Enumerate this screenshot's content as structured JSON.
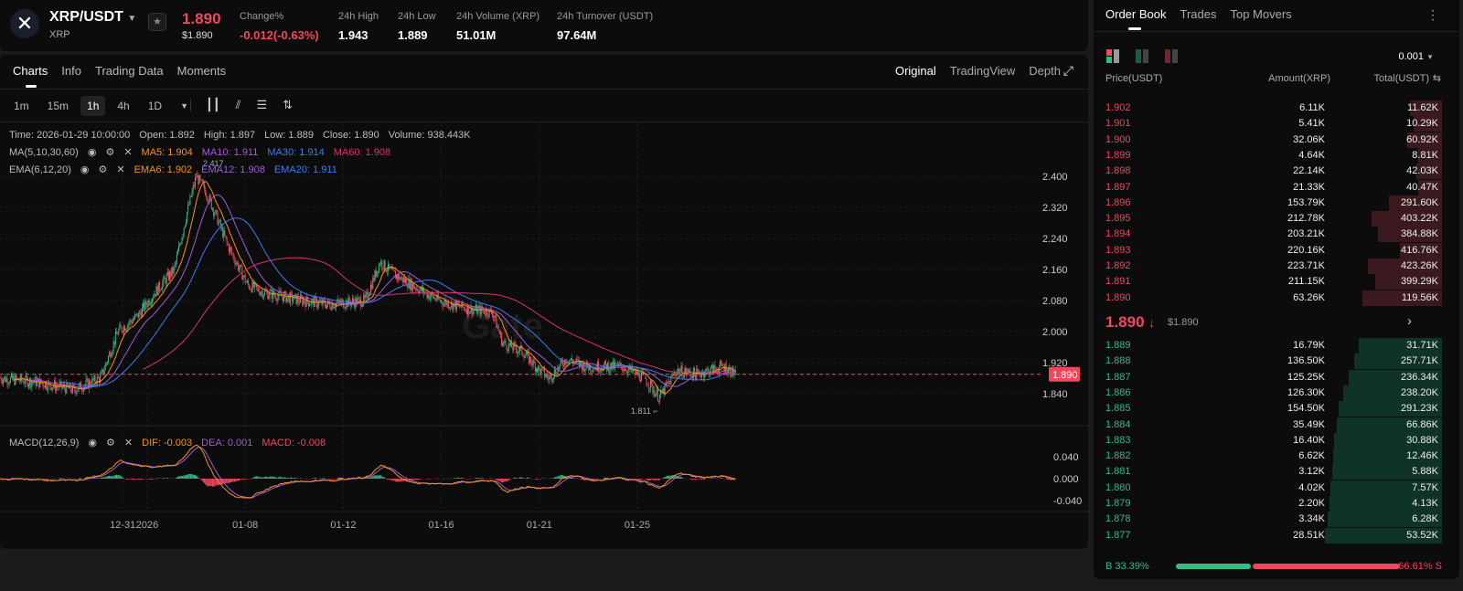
{
  "header": {
    "pair": "XRP/USDT",
    "base": "XRP",
    "last_price": "1.890",
    "last_price_usd": "$1.890",
    "stats": [
      {
        "label": "Change%",
        "value": "-0.012(-0.63%)",
        "color": "#f0485c"
      },
      {
        "label": "24h High",
        "value": "1.943"
      },
      {
        "label": "24h Low",
        "value": "1.889"
      },
      {
        "label": "24h Volume (XRP)",
        "value": "51.01M"
      },
      {
        "label": "24h Turnover (USDT)",
        "value": "97.64M"
      }
    ]
  },
  "tabs": [
    "Charts",
    "Info",
    "Trading Data",
    "Moments"
  ],
  "view_tabs": [
    "Original",
    "TradingView",
    "Depth"
  ],
  "intervals": [
    "1m",
    "15m",
    "1h",
    "4h",
    "1D"
  ],
  "active_interval": "1h",
  "legend": {
    "ohlc": [
      "Time: 2026-01-29 10:00:00",
      "Open: 1.892",
      "High: 1.897",
      "Low: 1.889",
      "Close: 1.890",
      "Volume: 938.443K"
    ],
    "ma_label": "MA(5,10,30,60)",
    "ma": [
      {
        "t": "MA5: 1.904",
        "c": "#f7931a"
      },
      {
        "t": "MA10: 1.911",
        "c": "#a05cd6"
      },
      {
        "t": "MA30: 1.914",
        "c": "#3d7bf2"
      },
      {
        "t": "MA60: 1.908",
        "c": "#d8336b"
      }
    ],
    "ema_label": "EMA(6,12,20)",
    "ema": [
      {
        "t": "EMA6: 1.902",
        "c": "#f7931a"
      },
      {
        "t": "EMA12: 1.908",
        "c": "#a05cd6"
      },
      {
        "t": "EMA20: 1.911",
        "c": "#3d7bf2"
      }
    ],
    "macd_label": "MACD(12,26,9)",
    "macd": [
      {
        "t": "DIF: -0.003",
        "c": "#f7931a"
      },
      {
        "t": "DEA: 0.001",
        "c": "#a05cd6"
      },
      {
        "t": "MACD: -0.008",
        "c": "#f0485c"
      }
    ]
  },
  "chart_data": {
    "type": "candlestick",
    "watermark": "Gate",
    "y_ticks": [
      "2.400",
      "2.320",
      "2.240",
      "2.160",
      "2.080",
      "2.000",
      "1.920",
      "1.840"
    ],
    "ylim": [
      1.78,
      2.44
    ],
    "macd_ticks": [
      "0.040",
      "0.000",
      "-0.040"
    ],
    "x_ticks": [
      {
        "label": "12-31",
        "day": -1
      },
      {
        "label": "2026",
        "day": 0
      },
      {
        "label": "01-08",
        "day": 4
      },
      {
        "label": "01-12",
        "day": 8
      },
      {
        "label": "01-16",
        "day": 12
      },
      {
        "label": "01-21",
        "day": 16
      },
      {
        "label": "01-25",
        "day": 20
      }
    ],
    "price_path": [
      [
        -6,
        1.88
      ],
      [
        -4.5,
        1.87
      ],
      [
        -3,
        1.85
      ],
      [
        -1.9,
        1.88
      ],
      [
        -1.2,
        2.0
      ],
      [
        -0.4,
        2.04
      ],
      [
        0.3,
        2.1
      ],
      [
        1.1,
        2.16
      ],
      [
        1.6,
        2.3
      ],
      [
        2.0,
        2.4
      ],
      [
        2.4,
        2.36
      ],
      [
        2.8,
        2.3
      ],
      [
        3.3,
        2.22
      ],
      [
        4.1,
        2.12
      ],
      [
        4.8,
        2.1
      ],
      [
        6.3,
        2.08
      ],
      [
        7.4,
        2.07
      ],
      [
        8.9,
        2.08
      ],
      [
        9.5,
        2.18
      ],
      [
        10.0,
        2.15
      ],
      [
        10.8,
        2.12
      ],
      [
        11.9,
        2.08
      ],
      [
        13.0,
        2.06
      ],
      [
        14.1,
        2.05
      ],
      [
        14.5,
        1.97
      ],
      [
        15.3,
        1.95
      ],
      [
        16.0,
        1.9
      ],
      [
        16.4,
        1.88
      ],
      [
        17.1,
        1.93
      ],
      [
        17.9,
        1.91
      ],
      [
        19.4,
        1.91
      ],
      [
        20.3,
        1.88
      ],
      [
        20.9,
        1.83
      ],
      [
        21.6,
        1.9
      ],
      [
        22.4,
        1.89
      ],
      [
        23.5,
        1.91
      ],
      [
        24.04,
        1.89
      ]
    ],
    "high_label": "2.417",
    "low_label": "1.811",
    "current_price": "1.890"
  },
  "orderbook": {
    "tabs": [
      "Order Book",
      "Trades",
      "Top Movers"
    ],
    "precision": "0.001",
    "cols": [
      "Price(USDT)",
      "Amount(XRP)",
      "Total(USDT)"
    ],
    "asks": [
      [
        "1.902",
        "6.11K",
        "11.62K",
        0.27
      ],
      [
        "1.901",
        "5.41K",
        "10.29K",
        0.24
      ],
      [
        "1.900",
        "32.06K",
        "60.92K",
        0.3
      ],
      [
        "1.899",
        "4.64K",
        "8.81K",
        0.2
      ],
      [
        "1.898",
        "22.14K",
        "42.03K",
        0.22
      ],
      [
        "1.897",
        "21.33K",
        "40.47K",
        0.2
      ],
      [
        "1.896",
        "153.79K",
        "291.60K",
        0.45
      ],
      [
        "1.895",
        "212.78K",
        "403.22K",
        0.6
      ],
      [
        "1.894",
        "203.21K",
        "384.88K",
        0.55
      ],
      [
        "1.893",
        "220.16K",
        "416.76K",
        0.36
      ],
      [
        "1.892",
        "223.71K",
        "423.26K",
        0.63
      ],
      [
        "1.891",
        "211.15K",
        "399.29K",
        0.57
      ],
      [
        "1.890",
        "63.26K",
        "119.56K",
        0.68
      ]
    ],
    "mid_price": "1.890",
    "mid_usd": "$1.890",
    "bids": [
      [
        "1.889",
        "16.79K",
        "31.71K",
        0.71
      ],
      [
        "1.888",
        "136.50K",
        "257.71K",
        0.75
      ],
      [
        "1.887",
        "125.25K",
        "236.34K",
        0.8
      ],
      [
        "1.886",
        "126.30K",
        "238.20K",
        0.84
      ],
      [
        "1.885",
        "154.50K",
        "291.23K",
        0.88
      ],
      [
        "1.884",
        "35.49K",
        "66.86K",
        0.9
      ],
      [
        "1.883",
        "16.40K",
        "30.88K",
        0.92
      ],
      [
        "1.882",
        "6.62K",
        "12.46K",
        0.93
      ],
      [
        "1.881",
        "3.12K",
        "5.88K",
        0.94
      ],
      [
        "1.880",
        "4.02K",
        "7.57K",
        0.95
      ],
      [
        "1.879",
        "2.20K",
        "4.13K",
        0.96
      ],
      [
        "1.878",
        "3.34K",
        "6.28K",
        0.98
      ],
      [
        "1.877",
        "28.51K",
        "53.52K",
        1.0
      ]
    ],
    "buy_pct": "B 33.39%",
    "sell_pct": "66.61% S",
    "buy_ratio": 0.3339
  },
  "colors": {
    "up": "#2ebd85",
    "down": "#f0485c"
  }
}
